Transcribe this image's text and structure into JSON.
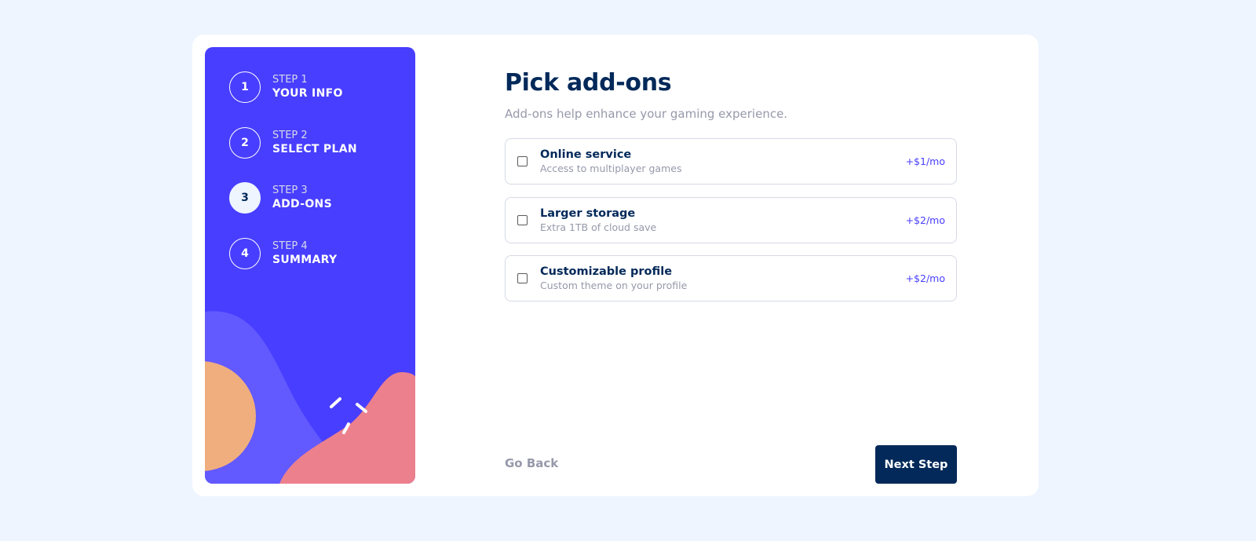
{
  "sidebar": {
    "steps": [
      {
        "number": "1",
        "label": "STEP 1",
        "title": "YOUR INFO",
        "active": false
      },
      {
        "number": "2",
        "label": "STEP 2",
        "title": "SELECT PLAN",
        "active": false
      },
      {
        "number": "3",
        "label": "STEP 3",
        "title": "ADD-ONS",
        "active": true
      },
      {
        "number": "4",
        "label": "STEP 4",
        "title": "SUMMARY",
        "active": false
      }
    ]
  },
  "main": {
    "title": "Pick add-ons",
    "subtitle": "Add-ons help enhance your gaming experience.",
    "addons": [
      {
        "name": "Online service",
        "description": "Access to multiplayer games",
        "price": "+$1/mo",
        "checked": false
      },
      {
        "name": "Larger storage",
        "description": "Extra 1TB of cloud save",
        "price": "+$2/mo",
        "checked": false
      },
      {
        "name": "Customizable profile",
        "description": "Custom theme on your profile",
        "price": "+$2/mo",
        "checked": false
      }
    ],
    "back_label": "Go Back",
    "next_label": "Next Step"
  },
  "colors": {
    "page_bg": "#eef5ff",
    "sidebar_bg": "#483eff",
    "primary_text": "#022959",
    "muted_text": "#9699aa",
    "accent": "#483eff",
    "button_bg": "#022959",
    "blob_violet": "#6259ff",
    "blob_orange": "#ffaf7e",
    "blob_pink": "#f9818e"
  }
}
